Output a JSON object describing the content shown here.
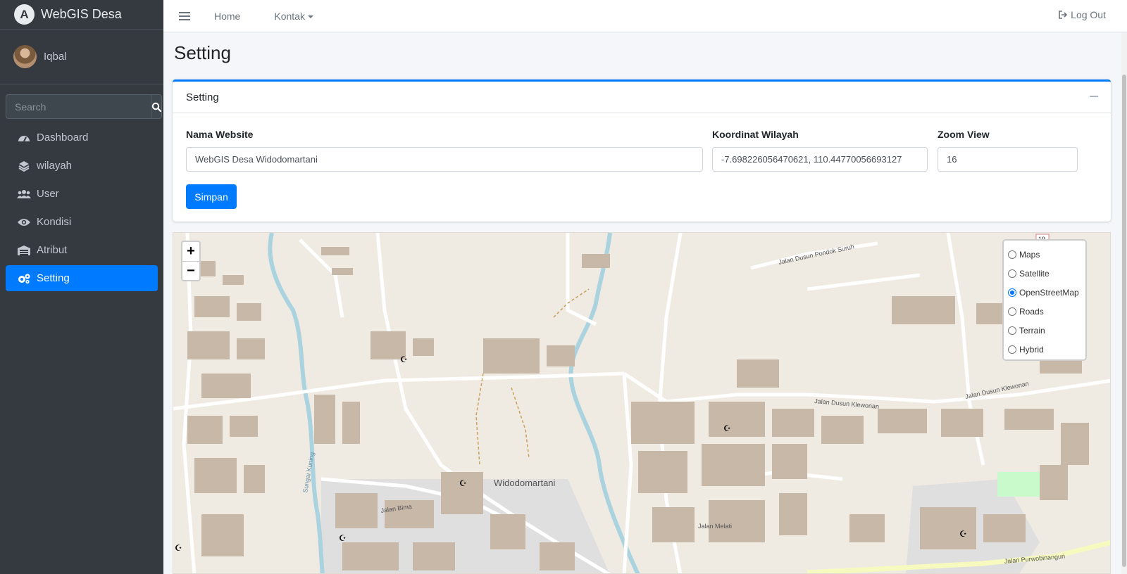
{
  "brand": {
    "name": "WebGIS Desa",
    "logo_letter": "A"
  },
  "user": {
    "name": "Iqbal"
  },
  "sidebar_search": {
    "placeholder": "Search"
  },
  "nav": [
    {
      "label": "Dashboard",
      "icon": "dashboard-icon"
    },
    {
      "label": "wilayah",
      "icon": "layers-icon"
    },
    {
      "label": "User",
      "icon": "users-icon"
    },
    {
      "label": "Kondisi",
      "icon": "eye-icon"
    },
    {
      "label": "Atribut",
      "icon": "warehouse-icon"
    },
    {
      "label": "Setting",
      "icon": "gears-icon",
      "active": true
    }
  ],
  "topbar": {
    "home": "Home",
    "kontak": "Kontak",
    "logout": "Log Out"
  },
  "page": {
    "title": "Setting"
  },
  "card": {
    "title": "Setting",
    "fields": {
      "nama_label": "Nama Website",
      "nama_value": "WebGIS Desa Widodomartani",
      "koordinat_label": "Koordinat Wilayah",
      "koordinat_value": "-7.698226056470621, 110.44770056693127",
      "zoom_label": "Zoom View",
      "zoom_value": "16"
    },
    "save_label": "Simpan"
  },
  "map": {
    "zoom_in": "+",
    "zoom_out": "−",
    "layers": [
      {
        "label": "Maps",
        "checked": false
      },
      {
        "label": "Satellite",
        "checked": false
      },
      {
        "label": "OpenStreetMap",
        "checked": true
      },
      {
        "label": "Roads",
        "checked": false
      },
      {
        "label": "Terrain",
        "checked": false
      },
      {
        "label": "Hybrid",
        "checked": false
      }
    ],
    "place_labels": {
      "village": "Widodomartani",
      "road_pondok_suruh": "Jalan Dusun Pondok Suruh",
      "road_klewonan": "Jalan Dusun Klewonan",
      "road_melati": "Jalan Melati",
      "road_purwobinangun": "Jalan Purwobinangun",
      "road_bima": "Jalan Bima",
      "river": "Sungai Kuning",
      "road_no": "19"
    },
    "colors": {
      "river": "#aad3df",
      "building": "#c7b8a8",
      "road": "#ffffff",
      "park": "#c8facc",
      "land": "#efeae2",
      "residential": "#e0dfdf"
    }
  }
}
